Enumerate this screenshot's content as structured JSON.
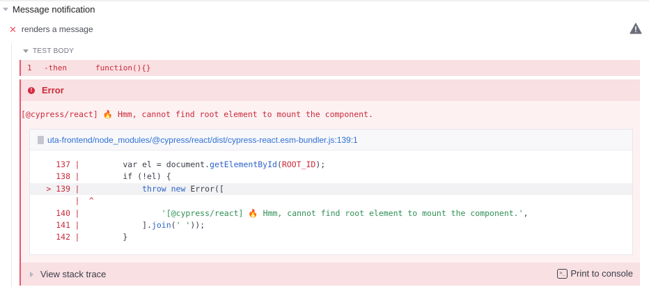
{
  "suite": {
    "title": "Message notification"
  },
  "test": {
    "status_icon": "✕",
    "title": "renders a message",
    "warning_icon": "warning-triangle"
  },
  "test_body": {
    "header": "TEST BODY",
    "command": {
      "number": "1",
      "name": "-then",
      "message": "function(){}"
    }
  },
  "error": {
    "icon_glyph": "!",
    "title": "Error",
    "message": "[@cypress/react] 🔥 Hmm, cannot find root element to mount the component.",
    "file_path": "uta-frontend/node_modules/@cypress/react/dist/cypress-react.esm-bundler.js:139:1",
    "code_frame": {
      "lines": [
        {
          "gutter": "  137",
          "bar": "|",
          "pre": "        var el = document.",
          "fn": "getElementById",
          "post": "(",
          "arg": "ROOT_ID",
          "tail": ");"
        },
        {
          "gutter": "  138",
          "bar": "|",
          "text": "        if (!el) {"
        },
        {
          "gutter": "> 139",
          "bar": "|",
          "pre": "            ",
          "kw": "throw new",
          "post": " Error(["
        },
        {
          "gutter": "",
          "bar": "|",
          "text": " ^"
        },
        {
          "gutter": "  140",
          "bar": "|",
          "pre": "                ",
          "str": "'[@cypress/react] 🔥 Hmm, cannot find root element to mount the component.'",
          "post": ","
        },
        {
          "gutter": "  141",
          "bar": "|",
          "pre": "            ].",
          "fn": "join",
          "post": "(",
          "str": "' '",
          "tail": "));"
        },
        {
          "gutter": "  142",
          "bar": "|",
          "text": "        }"
        }
      ]
    },
    "view_stack_trace": "View stack trace",
    "print_to_console": "Print to console"
  }
}
